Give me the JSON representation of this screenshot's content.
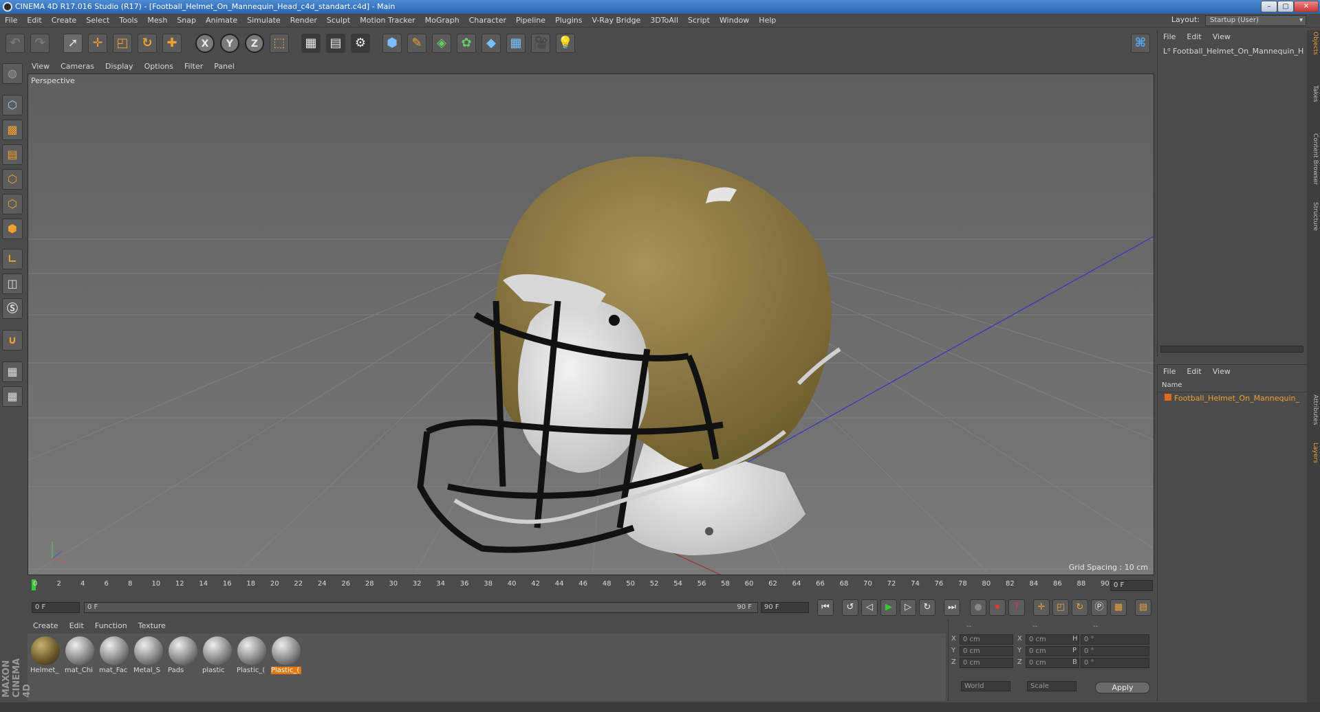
{
  "title": "CINEMA 4D R17.016 Studio (R17) - [Football_Helmet_On_Mannequin_Head_c4d_standart.c4d] - Main",
  "menu": [
    "File",
    "Edit",
    "Create",
    "Select",
    "Tools",
    "Mesh",
    "Snap",
    "Animate",
    "Simulate",
    "Render",
    "Sculpt",
    "Motion Tracker",
    "MoGraph",
    "Character",
    "Pipeline",
    "Plugins",
    "V-Ray Bridge",
    "3DToAll",
    "Script",
    "Window",
    "Help"
  ],
  "layout": {
    "label": "Layout:",
    "value": "Startup (User)"
  },
  "toolbar_axes": [
    "X",
    "Y",
    "Z"
  ],
  "viewport": {
    "menu": [
      "View",
      "Cameras",
      "Display",
      "Options",
      "Filter",
      "Panel"
    ],
    "label": "Perspective",
    "grid_spacing": "Grid Spacing : 10 cm"
  },
  "timeline": {
    "ticks": [
      "0",
      "2",
      "4",
      "6",
      "8",
      "10",
      "12",
      "14",
      "16",
      "18",
      "20",
      "22",
      "24",
      "26",
      "28",
      "30",
      "32",
      "34",
      "36",
      "38",
      "40",
      "42",
      "44",
      "46",
      "48",
      "50",
      "52",
      "54",
      "56",
      "58",
      "60",
      "62",
      "64",
      "66",
      "68",
      "70",
      "72",
      "74",
      "76",
      "78",
      "80",
      "82",
      "84",
      "86",
      "88",
      "90"
    ],
    "current": "0 F",
    "start": "0 F",
    "range_start": "0 F",
    "range_end": "90 F",
    "end": "90 F"
  },
  "material_menu": [
    "Create",
    "Edit",
    "Function",
    "Texture"
  ],
  "materials": [
    {
      "name": "Helmet_",
      "color": "#7a6a3a"
    },
    {
      "name": "mat_Chi",
      "color": "#888888"
    },
    {
      "name": "mat_Fac",
      "color": "#888888"
    },
    {
      "name": "Metal_S",
      "color": "#888888"
    },
    {
      "name": "Pads",
      "color": "#999999"
    },
    {
      "name": "plastic",
      "color": "#aaaaaa"
    },
    {
      "name": "Plastic_(",
      "color": "#888888"
    },
    {
      "name": "Plastic_(",
      "color": "#aaaaaa",
      "selected": true
    }
  ],
  "coords": {
    "headers": [
      "--",
      "--",
      "--"
    ],
    "rows": [
      {
        "a": "X",
        "av": "0 cm",
        "b": "X",
        "bv": "0 cm",
        "c": "H",
        "cv": "0 °"
      },
      {
        "a": "Y",
        "av": "0 cm",
        "b": "Y",
        "bv": "0 cm",
        "c": "P",
        "cv": "0 °"
      },
      {
        "a": "Z",
        "av": "0 cm",
        "b": "Z",
        "bv": "0 cm",
        "c": "B",
        "cv": "0 °"
      }
    ],
    "space": "World",
    "mode": "Scale",
    "apply": "Apply"
  },
  "object_panel": {
    "menu": [
      "File",
      "Edit",
      "View"
    ],
    "object": "Football_Helmet_On_Mannequin_H"
  },
  "layer_panel": {
    "menu": [
      "File",
      "Edit",
      "View"
    ],
    "column": "Name",
    "layer": "Football_Helmet_On_Mannequin_"
  },
  "right_tabs": [
    "Objects",
    "Takes",
    "Content Browser",
    "Structure",
    "Attributes",
    "Layers"
  ],
  "brand": "MAXON CINEMA 4D"
}
